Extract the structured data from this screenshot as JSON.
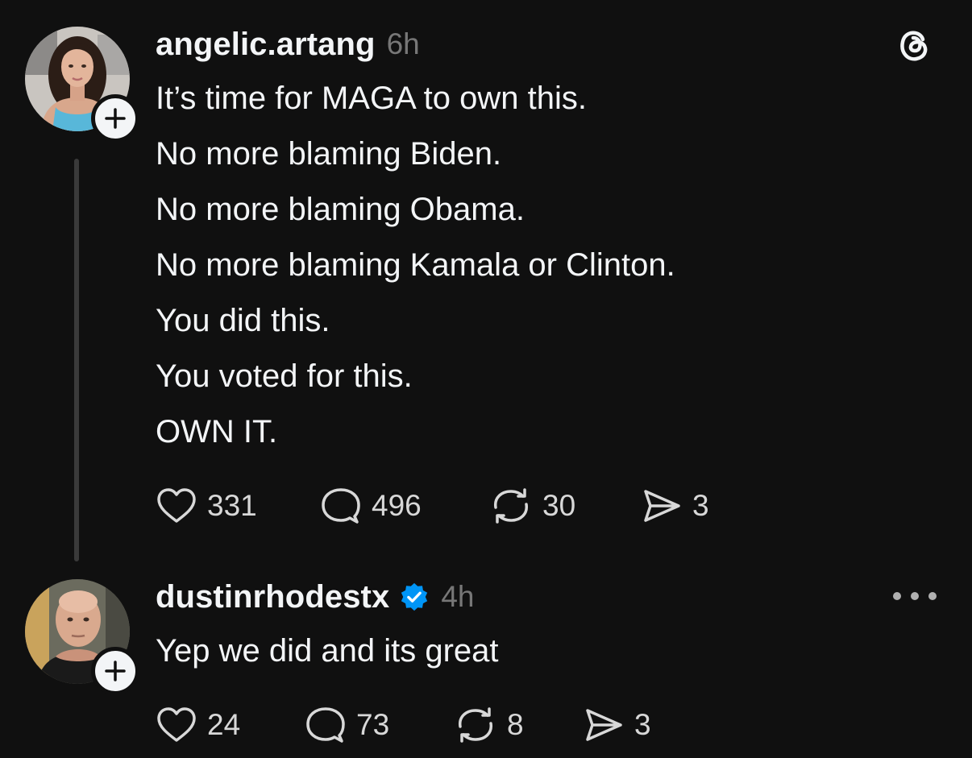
{
  "app": {
    "logo_icon": "threads-logo-icon"
  },
  "colors": {
    "background": "#101010",
    "text": "#f3f5f7",
    "muted": "#777777",
    "verified": "#0095f6"
  },
  "posts": [
    {
      "username": "angelic.artang",
      "time": "6h",
      "verified": false,
      "lines": [
        "It’s time for MAGA to own this.",
        "No more blaming Biden.",
        "No more blaming Obama.",
        "No more blaming Kamala or Clinton.",
        "You did this.",
        "You voted for this.",
        "OWN IT."
      ],
      "actions": {
        "likes": "331",
        "replies": "496",
        "reposts": "30",
        "shares": "3"
      }
    },
    {
      "username": "dustinrhodestx",
      "time": "4h",
      "verified": true,
      "lines": [
        "Yep we did and its great"
      ],
      "actions": {
        "likes": "24",
        "replies": "73",
        "reposts": "8",
        "shares": "3"
      }
    }
  ]
}
